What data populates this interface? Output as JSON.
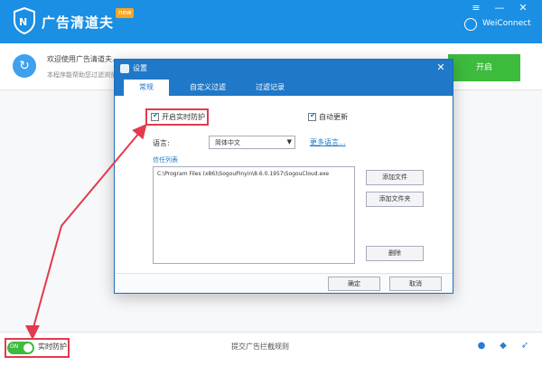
{
  "header": {
    "title": "广告清道夫",
    "badge": "new",
    "wechat_label": "WeiConnect"
  },
  "banner": {
    "line1": "欢迎使用广告清道夫...",
    "line2": "本程序能帮助您过滤浏览器广告",
    "open_button": "开启"
  },
  "dialog": {
    "title": "设置",
    "tabs": [
      "常规",
      "自定义过滤",
      "过滤记录"
    ],
    "realtime_checkbox": "开启实时防护",
    "autostart_checkbox": "自动更新",
    "language_label": "语言:",
    "language_value": "简体中文",
    "more_languages": "更多语言...",
    "trust_label": "信任列表",
    "trust_items": [
      "C:\\Program Files (x86)\\SogouPinyin\\8.6.0.1957\\SogouCloud.exe"
    ],
    "add_file_button": "添加文件",
    "add_folder_button": "添加文件夹",
    "delete_button": "删除",
    "ok_button": "确定",
    "cancel_button": "取消"
  },
  "statusbar": {
    "toggle_label": "ON",
    "realtime_label": "实时防护",
    "center_link": "提交广告拦截规则"
  },
  "colors": {
    "brand_blue": "#1a8fe3",
    "dialog_blue": "#1f78c8",
    "green": "#3dbb3d",
    "highlight_red": "#e33a4d"
  }
}
